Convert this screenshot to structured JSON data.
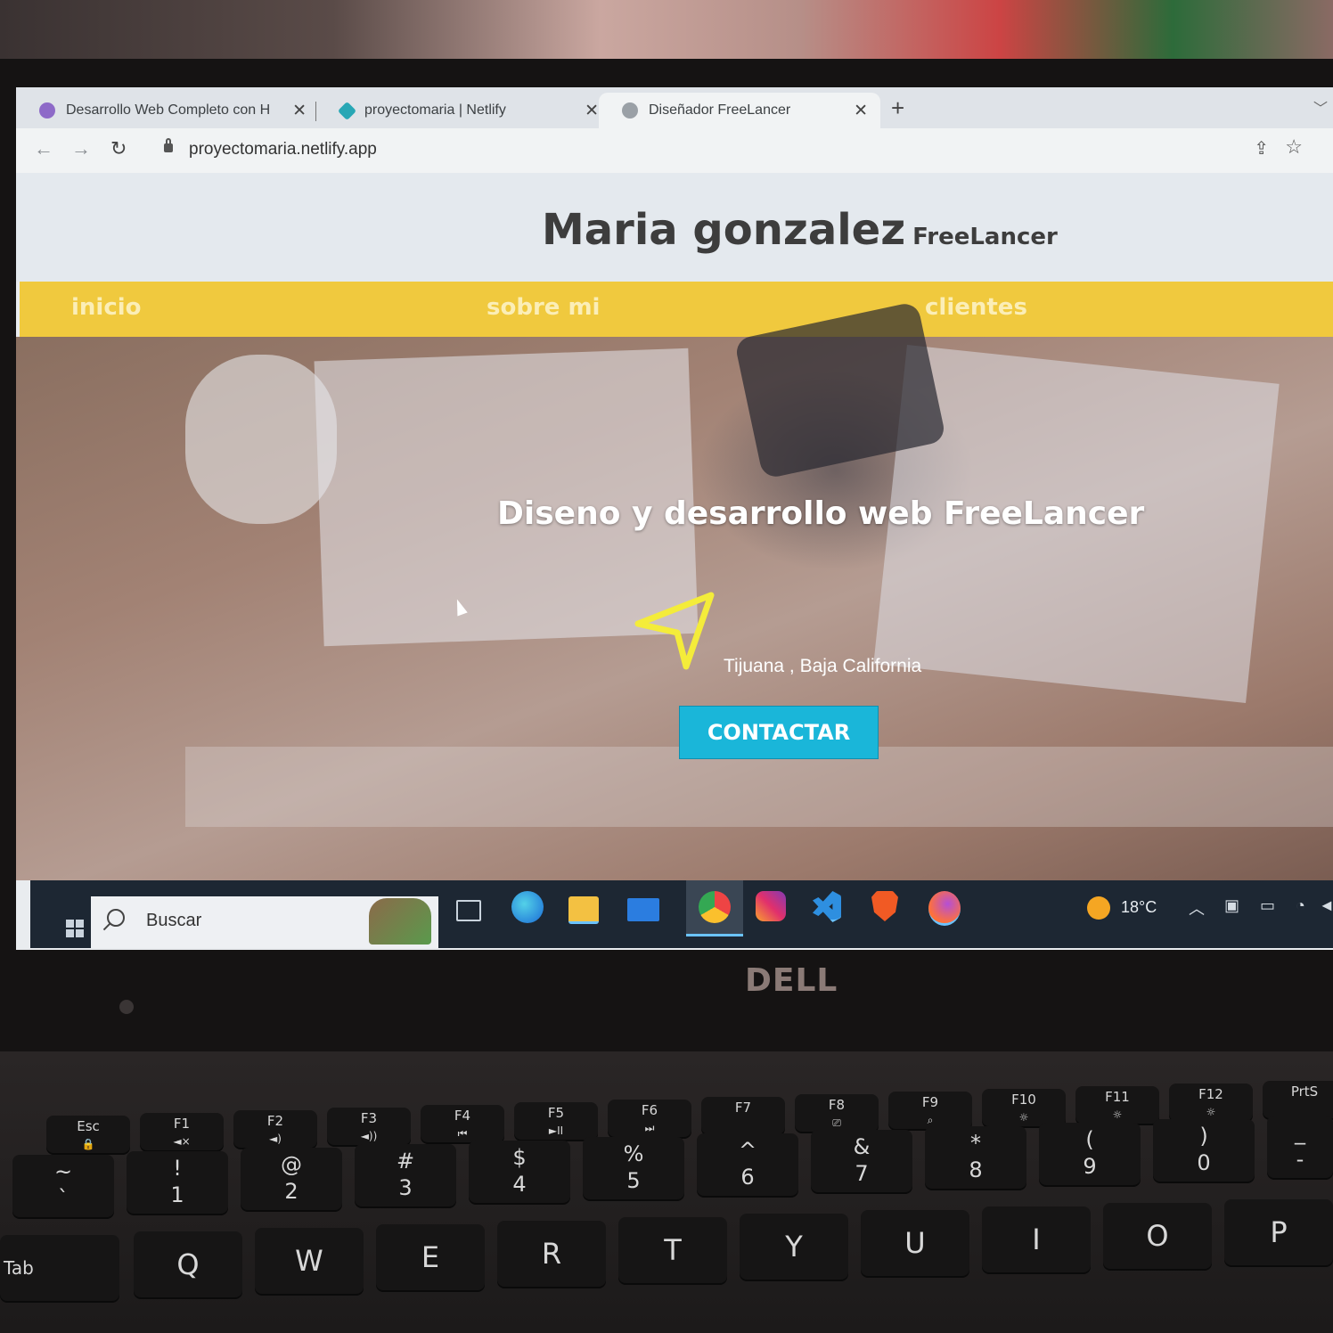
{
  "browser": {
    "tabs": [
      {
        "title": "Desarrollo Web Completo con H",
        "favicon": "udemy-icon",
        "close": "✕"
      },
      {
        "title": "proyectomaria | Netlify",
        "favicon": "netlify-icon",
        "close": "✕"
      },
      {
        "title": "Diseñador FreeLancer",
        "favicon": "globe-icon",
        "close": "✕",
        "active": true
      }
    ],
    "new_tab": "+",
    "url": "proyectomaria.netlify.app"
  },
  "site": {
    "title": "Maria gonzalez",
    "subtitle": "FreeLancer",
    "nav": [
      "inicio",
      "sobre mi",
      "clientes"
    ],
    "hero_title": "Diseno y desarrollo web FreeLancer",
    "location": "Tijuana , Baja California",
    "cta": "CONTACTAR"
  },
  "taskbar": {
    "search_placeholder": "Buscar",
    "temperature": "18°C",
    "apps": [
      "task-view",
      "edge",
      "file-explorer",
      "mail",
      "chrome",
      "instagram",
      "vscode",
      "brave",
      "firefox"
    ]
  },
  "laptop": {
    "brand": "DELL"
  },
  "keyboard": {
    "fkeys": [
      {
        "top": "Esc",
        "bottom": "🔒"
      },
      {
        "top": "F1",
        "bottom": "◄×"
      },
      {
        "top": "F2",
        "bottom": "◄)"
      },
      {
        "top": "F3",
        "bottom": "◄))"
      },
      {
        "top": "F4",
        "bottom": "⏮"
      },
      {
        "top": "F5",
        "bottom": "►II"
      },
      {
        "top": "F6",
        "bottom": "⏭"
      },
      {
        "top": "F7",
        "bottom": ""
      },
      {
        "top": "F8",
        "bottom": "⎚"
      },
      {
        "top": "F9",
        "bottom": "⌕"
      },
      {
        "top": "F10",
        "bottom": "☼"
      },
      {
        "top": "F11",
        "bottom": "☼"
      },
      {
        "top": "F12",
        "bottom": "☼"
      },
      {
        "top": "PrtS",
        "bottom": ""
      }
    ],
    "numkeys": [
      {
        "top": "~",
        "bottom": "`"
      },
      {
        "top": "!",
        "bottom": "1"
      },
      {
        "top": "@",
        "bottom": "2"
      },
      {
        "top": "#",
        "bottom": "3"
      },
      {
        "top": "$",
        "bottom": "4"
      },
      {
        "top": "%",
        "bottom": "5"
      },
      {
        "top": "^",
        "bottom": "6"
      },
      {
        "top": "&",
        "bottom": "7"
      },
      {
        "top": "*",
        "bottom": "8"
      },
      {
        "top": "(",
        "bottom": "9"
      },
      {
        "top": ")",
        "bottom": "0"
      },
      {
        "top": "_",
        "bottom": "-"
      }
    ],
    "letters": [
      "Tab",
      "Q",
      "W",
      "E",
      "R",
      "T",
      "Y",
      "U",
      "I",
      "O",
      "P"
    ]
  },
  "colors": {
    "nav_yellow": "#f0c93e",
    "cta_blue": "#1ab6d9",
    "header_bg": "#e4e9ee",
    "taskbar": "#1d2733"
  }
}
